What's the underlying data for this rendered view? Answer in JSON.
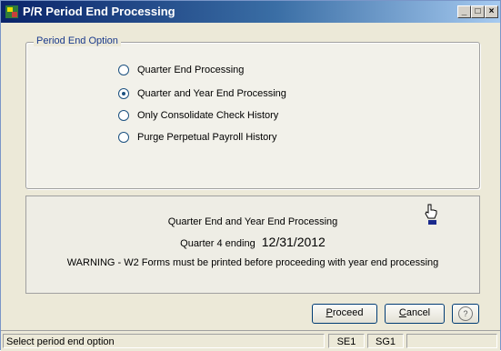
{
  "window": {
    "title": "P/R Period End Processing",
    "icon": "app-icon",
    "controls": {
      "minimize": "_",
      "maximize": "□",
      "close": "×"
    }
  },
  "group": {
    "legend": "Period End Option",
    "options": [
      {
        "label": "Quarter End Processing",
        "checked": false
      },
      {
        "label": "Quarter and Year End Processing",
        "checked": true
      },
      {
        "label": "Only Consolidate Check History",
        "checked": false
      },
      {
        "label": "Purge Perpetual Payroll History",
        "checked": false
      }
    ]
  },
  "info": {
    "line1": "Quarter End and Year End Processing",
    "line2_prefix": "Quarter 4 ending",
    "line2_date": "12/31/2012",
    "warning": "WARNING - W2 Forms must be printed before proceeding with year end processing"
  },
  "buttons": {
    "proceed_rest": "roceed",
    "proceed_mnemonic": "P",
    "cancel_rest": "ancel",
    "cancel_mnemonic": "C",
    "help": "?"
  },
  "status": {
    "message": "Select period end option",
    "panel1": "SE1",
    "panel2": "SG1",
    "panel3": ""
  },
  "colors": {
    "title_bar": "#0a246a",
    "legend_text": "#1a3a8c",
    "window_bg": "#ece9d8"
  }
}
